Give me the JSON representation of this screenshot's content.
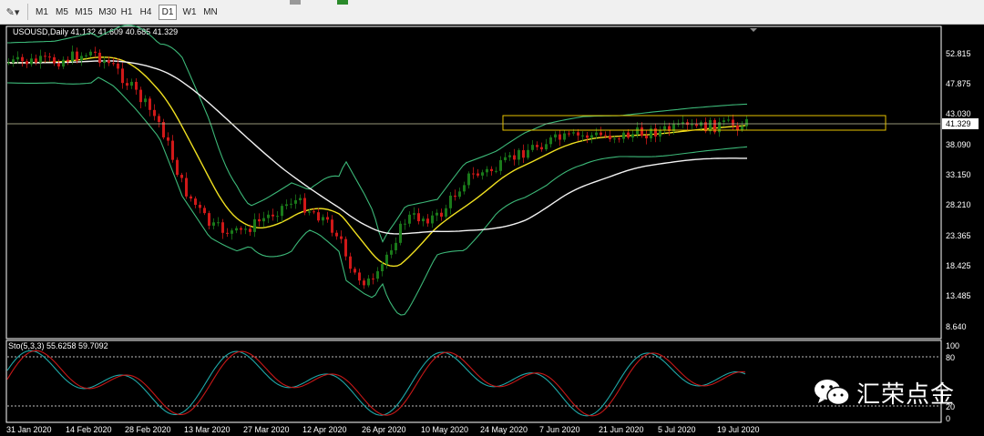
{
  "toolbar": {
    "timeframes": [
      "M1",
      "M5",
      "M15",
      "M30",
      "H1",
      "H4",
      "D1",
      "W1",
      "MN"
    ],
    "active": "D1"
  },
  "chart": {
    "symbol_info": "USOUSD,Daily  41.132 41.609 40.685 41.329",
    "current_price": "41.329",
    "price_ticks": [
      "52.815",
      "47.875",
      "43.030",
      "38.090",
      "33.150",
      "28.210",
      "23.365",
      "18.425",
      "13.485",
      "8.640"
    ],
    "osc_label": "Sto(5,3,3) 55.6258 59.7092",
    "osc_ticks": [
      "100",
      "80",
      "20",
      "0"
    ],
    "date_labels": [
      "31 Jan 2020",
      "14 Feb 2020",
      "28 Feb 2020",
      "13 Mar 2020",
      "27 Mar 2020",
      "12 Apr 2020",
      "26 Apr 2020",
      "10 May 2020",
      "24 May 2020",
      "7 Jun 2020",
      "21 Jun 2020",
      "5 Jul 2020",
      "19 Jul 2020"
    ]
  },
  "watermark": {
    "text": "汇荣点金",
    "icon": "wechat-icon"
  },
  "colors": {
    "background": "#000000",
    "bull": "#1a7a1a",
    "bear": "#d01818",
    "bands": "#3cb878",
    "ma_fast": "#f0e020",
    "ma_slow": "#f2f2f2",
    "stoch_main": "#1fa8a8",
    "stoch_signal": "#c81818",
    "box": "#e6c200"
  }
}
